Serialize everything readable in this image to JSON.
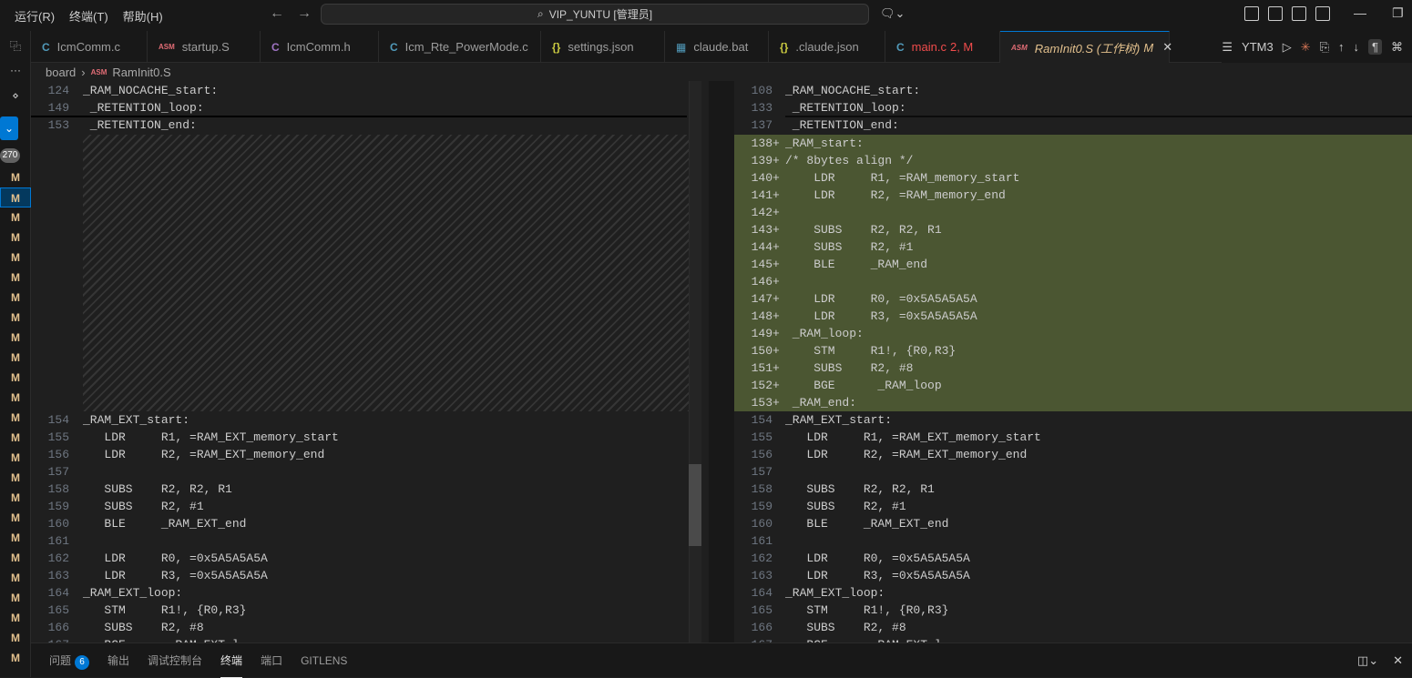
{
  "menu": [
    "运行(R)",
    "终端(T)",
    "帮助(H)"
  ],
  "search": {
    "text": "VIP_YUNTU [管理员]"
  },
  "tabs": [
    {
      "icon": "C",
      "label": "IcmComm.c",
      "color": "#519aba"
    },
    {
      "icon": "ASM",
      "label": "startup.S",
      "color": "#e06c75"
    },
    {
      "icon": "C",
      "label": "IcmComm.h",
      "color": "#a074c4"
    },
    {
      "icon": "C",
      "label": "Icm_Rte_PowerMode.c",
      "color": "#519aba"
    },
    {
      "icon": "{}",
      "label": "settings.json",
      "color": "#cbcb41"
    },
    {
      "icon": "▦",
      "label": "claude.bat",
      "color": "#519aba"
    },
    {
      "icon": "{}",
      "label": ".claude.json",
      "color": "#cbcb41"
    },
    {
      "icon": "C",
      "label": "main.c",
      "suffix": "2, M",
      "color": "#519aba"
    },
    {
      "icon": "ASM",
      "label": "RamInit0.S (工作树)",
      "suffix": "M",
      "color": "#e06c75"
    }
  ],
  "tab_tools": {
    "outline": "YTM3"
  },
  "breadcrumb": {
    "folder": "board",
    "file": "RamInit0.S"
  },
  "activity": {
    "badge": "270",
    "mod_letter": "M"
  },
  "left_editor": {
    "sticky": [
      {
        "n": "124",
        "t": "_RAM_NOCACHE_start:"
      },
      {
        "n": "149",
        "t": " _RETENTION_loop:"
      },
      {
        "n": "153",
        "t": " _RETENTION_end:"
      }
    ],
    "lines": [
      {
        "n": "154",
        "t": "_RAM_EXT_start:"
      },
      {
        "n": "155",
        "t": "   LDR     R1, =RAM_EXT_memory_start"
      },
      {
        "n": "156",
        "t": "   LDR     R2, =RAM_EXT_memory_end"
      },
      {
        "n": "157",
        "t": ""
      },
      {
        "n": "158",
        "t": "   SUBS    R2, R2, R1"
      },
      {
        "n": "159",
        "t": "   SUBS    R2, #1"
      },
      {
        "n": "160",
        "t": "   BLE     _RAM_EXT_end"
      },
      {
        "n": "161",
        "t": ""
      },
      {
        "n": "162",
        "t": "   LDR     R0, =0x5A5A5A5A"
      },
      {
        "n": "163",
        "t": "   LDR     R3, =0x5A5A5A5A"
      },
      {
        "n": "164",
        "t": "_RAM_EXT_loop:"
      },
      {
        "n": "165",
        "t": "   STM     R1!, {R0,R3}"
      },
      {
        "n": "166",
        "t": "   SUBS    R2, #8"
      },
      {
        "n": "167",
        "t": "   BGE      _RAM_EXT_l"
      }
    ]
  },
  "right_editor": {
    "sticky": [
      {
        "n": "108",
        "t": "_RAM_NOCACHE_start:"
      },
      {
        "n": "133",
        "t": " _RETENTION_loop:"
      },
      {
        "n": "137",
        "t": " _RETENTION_end:"
      }
    ],
    "added": [
      {
        "n": "138",
        "t": "_RAM_start:"
      },
      {
        "n": "139",
        "t": "/* 8bytes align */"
      },
      {
        "n": "140",
        "t": "    LDR     R1, =RAM_memory_start"
      },
      {
        "n": "141",
        "t": "    LDR     R2, =RAM_memory_end"
      },
      {
        "n": "142",
        "t": ""
      },
      {
        "n": "143",
        "t": "    SUBS    R2, R2, R1"
      },
      {
        "n": "144",
        "t": "    SUBS    R2, #1"
      },
      {
        "n": "145",
        "t": "    BLE     _RAM_end"
      },
      {
        "n": "146",
        "t": ""
      },
      {
        "n": "147",
        "t": "    LDR     R0, =0x5A5A5A5A"
      },
      {
        "n": "148",
        "t": "    LDR     R3, =0x5A5A5A5A"
      },
      {
        "n": "149",
        "t": " _RAM_loop:"
      },
      {
        "n": "150",
        "t": "    STM     R1!, {R0,R3}"
      },
      {
        "n": "151",
        "t": "    SUBS    R2, #8"
      },
      {
        "n": "152",
        "t": "    BGE      _RAM_loop"
      },
      {
        "n": "153",
        "t": " _RAM_end:"
      }
    ],
    "lines": [
      {
        "n": "154",
        "t": "_RAM_EXT_start:"
      },
      {
        "n": "155",
        "t": "   LDR     R1, =RAM_EXT_memory_start"
      },
      {
        "n": "156",
        "t": "   LDR     R2, =RAM_EXT_memory_end"
      },
      {
        "n": "157",
        "t": ""
      },
      {
        "n": "158",
        "t": "   SUBS    R2, R2, R1"
      },
      {
        "n": "159",
        "t": "   SUBS    R2, #1"
      },
      {
        "n": "160",
        "t": "   BLE     _RAM_EXT_end"
      },
      {
        "n": "161",
        "t": ""
      },
      {
        "n": "162",
        "t": "   LDR     R0, =0x5A5A5A5A"
      },
      {
        "n": "163",
        "t": "   LDR     R3, =0x5A5A5A5A"
      },
      {
        "n": "164",
        "t": "_RAM_EXT_loop:"
      },
      {
        "n": "165",
        "t": "   STM     R1!, {R0,R3}"
      },
      {
        "n": "166",
        "t": "   SUBS    R2, #8"
      },
      {
        "n": "167",
        "t": "   BGE      _RAM_EXT_l"
      }
    ]
  },
  "panel": {
    "tabs": [
      "问题",
      "输出",
      "调试控制台",
      "终端",
      "端口",
      "GITLENS"
    ],
    "problems_count": "6",
    "active": "终端"
  }
}
